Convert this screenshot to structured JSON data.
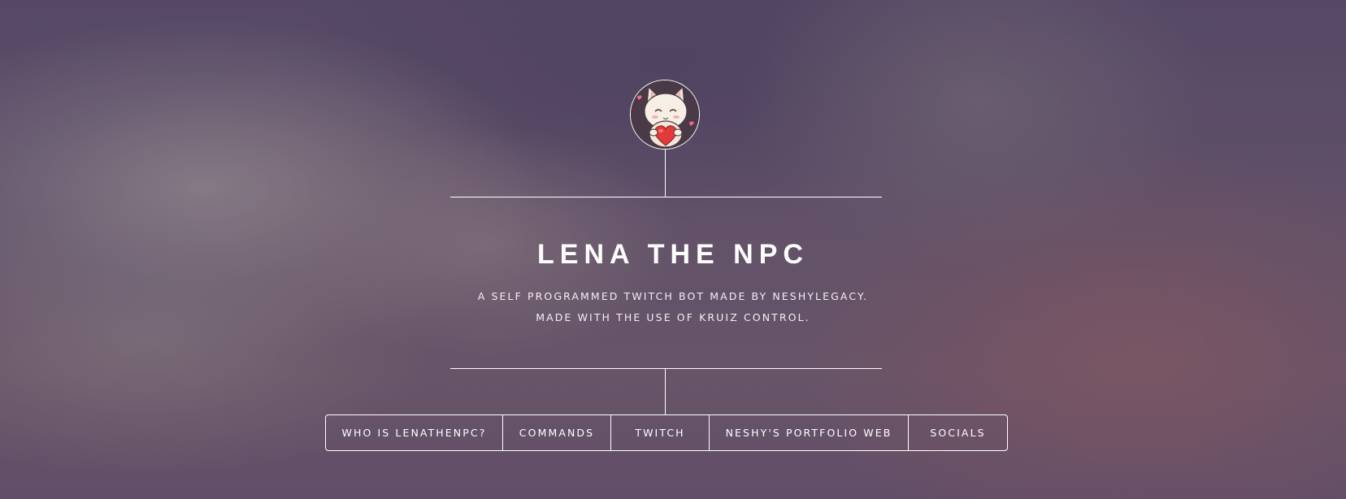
{
  "header": {
    "title": "LENA THE NPC",
    "subtitle_line1": "A SELF PROGRAMMED TWITCH BOT MADE BY NESHYLEGACY.",
    "subtitle_line2": "MADE WITH THE USE OF KRUIZ CONTROL."
  },
  "nav": {
    "items": [
      {
        "label": "WHO IS LENATHENPC?"
      },
      {
        "label": "COMMANDS"
      },
      {
        "label": "TWITCH"
      },
      {
        "label": "NESHY'S PORTFOLIO WEB"
      },
      {
        "label": "SOCIALS"
      }
    ]
  },
  "colors": {
    "line": "#ffffff",
    "text": "#ffffff",
    "background_base": "#5c4e6e"
  },
  "icons": {
    "avatar": "chibi-cat-holding-heart"
  }
}
